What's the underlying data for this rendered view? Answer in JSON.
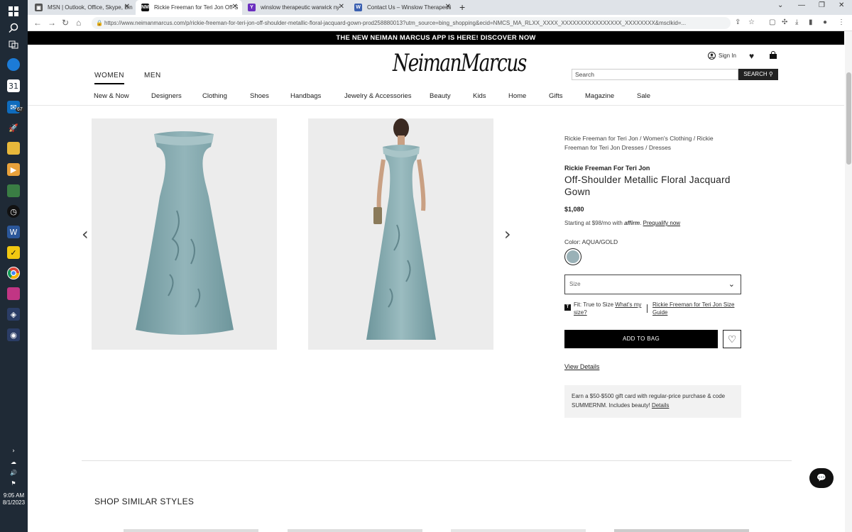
{
  "taskbar": {
    "mail_badge": "67",
    "time": "9:05 AM",
    "date": "8/1/2023"
  },
  "tabs": [
    {
      "title": "MSN | Outlook, Office, Skype, Bin",
      "favicon_color": "#555"
    },
    {
      "title": "Rickie Freeman for Teri Jon Off-S",
      "favicon_color": "#111"
    },
    {
      "title": "winslow therapeutic warwick ny",
      "favicon_color": "#6b2fbf"
    },
    {
      "title": "Contact Us – Winslow Therapeuti",
      "favicon_color": "#3a5fb0"
    }
  ],
  "address": {
    "url": "https://www.neimanmarcus.com/p/rickie-freeman-for-teri-jon-off-shoulder-metallic-floral-jacquard-gown-prod258880013?utm_source=bing_shopping&ecid=NMCS_MA_RLXX_XXXX_XXXXXXXXXXXXXXXX_XXXXXXXX&msclkid=..."
  },
  "banner": "THE NEW NEIMAN MARCUS APP IS HERE! DISCOVER NOW",
  "header": {
    "logo": "NeimanMarcus",
    "women": "WOMEN",
    "men": "MEN",
    "sign_in": "Sign In",
    "search_placeholder": "Search",
    "search_button": "SEARCH"
  },
  "categories": [
    "New & Now",
    "Designers",
    "Clothing",
    "Shoes",
    "Handbags",
    "Jewelry & Accessories",
    "Beauty",
    "Kids",
    "Home",
    "Gifts",
    "Magazine",
    "Sale"
  ],
  "product": {
    "breadcrumb": "Rickie Freeman for Teri Jon / Women's Clothing / Rickie Freeman for Teri Jon Dresses / Dresses",
    "brand": "Rickie Freeman For Teri Jon",
    "title": "Off-Shoulder Metallic Floral Jacquard Gown",
    "price": "$1,080",
    "affirm_text": "Starting at $98/mo with",
    "affirm_brand": "affirm",
    "prequalify": "Prequalify now",
    "color_label": "Color: AQUA/GOLD",
    "swatch_color": "#9ab1b7",
    "size_placeholder": "Size",
    "fit_prefix": "Fit: True to Size",
    "fit_link": "What's my size?",
    "size_guide": "Rickie Freeman for Teri Jon Size Guide",
    "add_to_bag": "ADD TO BAG",
    "view_details": "View Details",
    "promo_text": "Earn a $50-$500 gift card with regular-price purchase & code SUMMERNM. Includes beauty!",
    "promo_link": "Details"
  },
  "similar_heading": "SHOP SIMILAR STYLES",
  "colors": {
    "gown_light": "#8fb0b6",
    "gown_dark": "#5f878f",
    "image_bg": "#ececec"
  }
}
